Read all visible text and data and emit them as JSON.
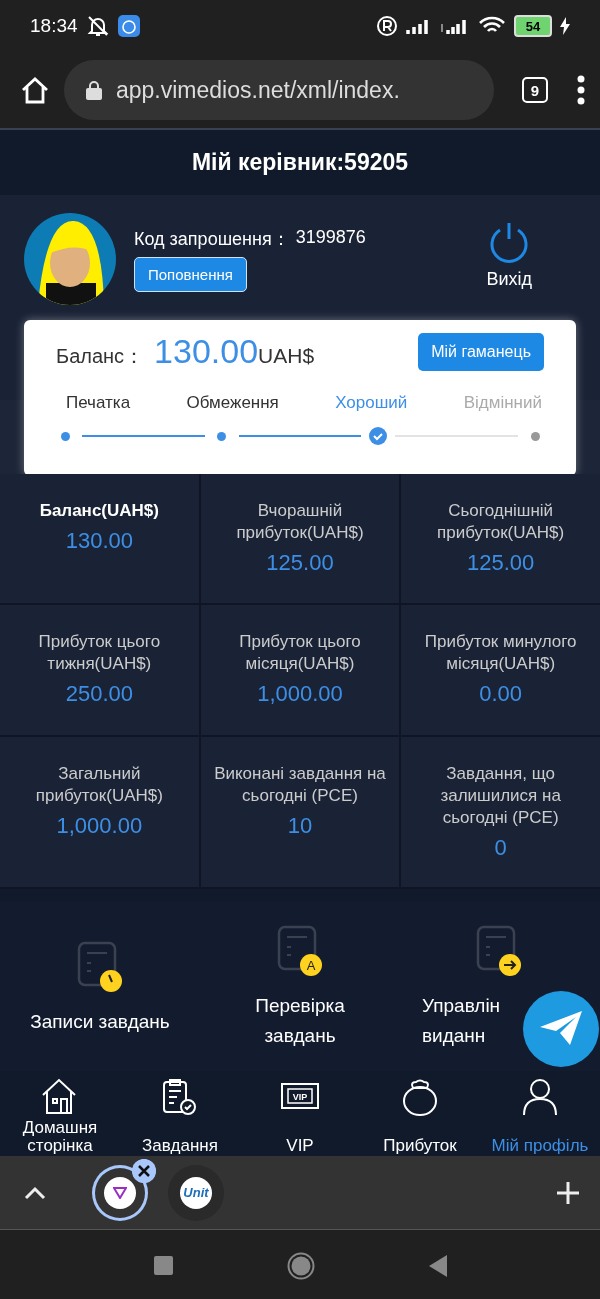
{
  "status_bar": {
    "time": "18:34",
    "battery": "54"
  },
  "browser": {
    "url": "app.vimedios.net/xml/index.",
    "tab_count": "9"
  },
  "header": {
    "title": "Мій керівник:59205"
  },
  "profile": {
    "invite_label": "Код запрошення：",
    "invite_code": "3199876",
    "topup_button": "Поповнення",
    "logout_label": "Вихід"
  },
  "balance_card": {
    "label": "Баланс：",
    "amount": "130.00",
    "currency": "UAH$",
    "wallet_button": "Мій гаманець",
    "steps": [
      {
        "label": "Печатка",
        "kind": "done"
      },
      {
        "label": "Обмеження",
        "kind": "done"
      },
      {
        "label": "Хороший",
        "kind": "current"
      },
      {
        "label": "Відмінний",
        "kind": "pending"
      }
    ]
  },
  "stats": [
    {
      "title": "Баланс(UAH$)",
      "value": "130.00",
      "highlighted": true
    },
    {
      "title": "Вчорашній прибуток(UAH$)",
      "value": "125.00",
      "highlighted": false
    },
    {
      "title": "Сьогоднішній прибуток(UAH$)",
      "value": "125.00",
      "highlighted": false
    },
    {
      "title": "Прибуток цього тижня(UAH$)",
      "value": "250.00",
      "highlighted": false
    },
    {
      "title": "Прибуток цього місяця(UAH$)",
      "value": "1,000.00",
      "highlighted": false
    },
    {
      "title": "Прибуток минулого місяця(UAH$)",
      "value": "0.00",
      "highlighted": false
    },
    {
      "title": "Загальний прибуток(UAH$)",
      "value": "1,000.00",
      "highlighted": false
    },
    {
      "title": "Виконані завдання на сьогодні (PCE)",
      "value": "10",
      "highlighted": false
    },
    {
      "title": "Завдання, що залишилися на сьогодні (PCE)",
      "value": "0",
      "highlighted": false
    }
  ],
  "actions": [
    {
      "kind": "clock",
      "lines": [
        "Записи завдань"
      ]
    },
    {
      "kind": "badge",
      "badge": "A",
      "lines": [
        "Перевірка",
        "завдань"
      ]
    },
    {
      "kind": "arrow",
      "lines": [
        "Управлін",
        "виданн"
      ]
    }
  ],
  "nav": [
    {
      "kind": "home",
      "label": "Домашня сторінка",
      "selected": false
    },
    {
      "kind": "tasks",
      "label": "Завдання",
      "selected": false
    },
    {
      "kind": "vip",
      "label": "VIP",
      "badge": "VIP",
      "selected": false
    },
    {
      "kind": "bag",
      "label": "Прибуток",
      "selected": false
    },
    {
      "kind": "person",
      "label": "Мій профіль",
      "selected": true
    }
  ],
  "tab_strip": {
    "groups": [
      {
        "kind": "logo",
        "selected": true
      },
      {
        "kind": "text",
        "text": "Unit",
        "selected": false
      }
    ]
  }
}
